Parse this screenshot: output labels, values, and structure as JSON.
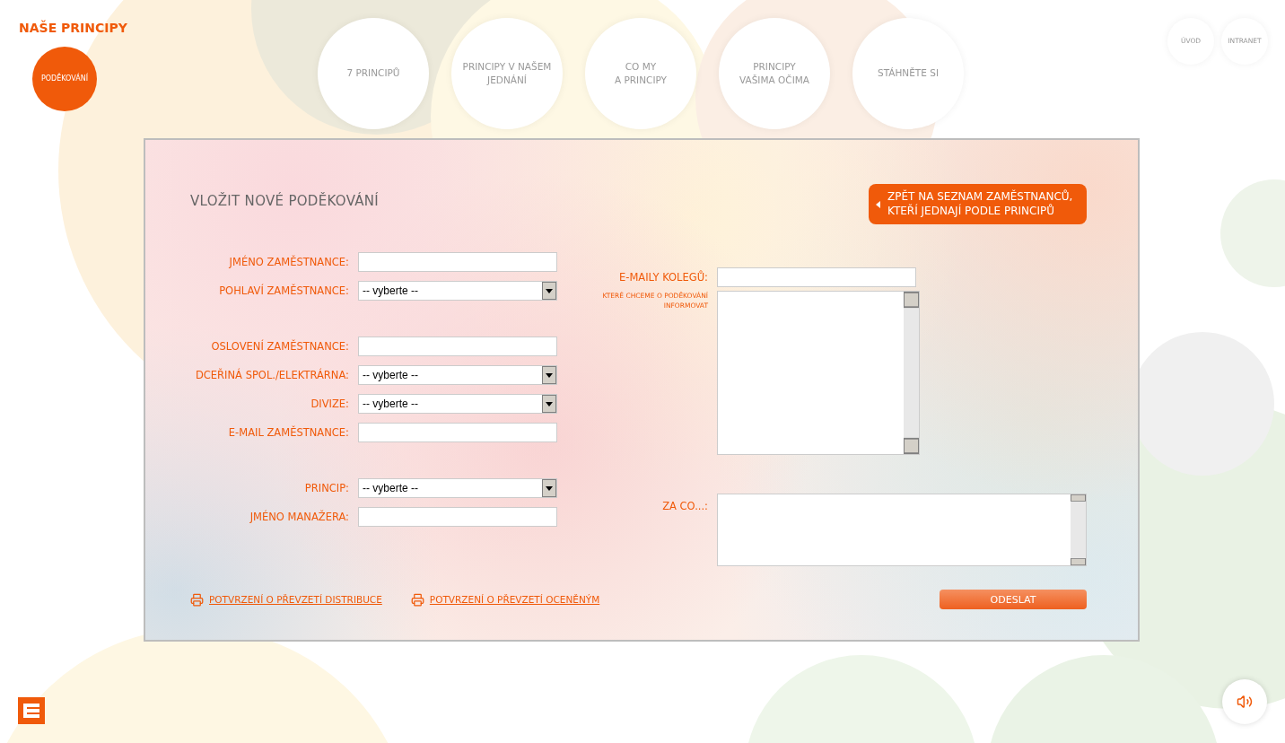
{
  "header": {
    "title": "NAŠE PRINCIPY",
    "current_item": {
      "label": "PODĚKOVÁNÍ",
      "selected": true
    },
    "nav": [
      {
        "label": "7 PRINCIPŮ",
        "selected": false
      },
      {
        "label": "PRINCIPY V NAŠEM JEDNÁNÍ",
        "selected": false
      },
      {
        "label": "CO MY\nA PRINCIPY",
        "selected": false
      },
      {
        "label": "PRINCIPY\nVAŠIMA OČIMA",
        "selected": false
      },
      {
        "label": "STÁHNĚTE SI",
        "selected": false
      }
    ],
    "utility": [
      {
        "label": "ÚVOD"
      },
      {
        "label": "INTRANET"
      }
    ]
  },
  "form": {
    "title": "VLOŽIT NOVÉ PODĚKOVÁNÍ",
    "back_button": "ZPĚT NA SEZNAM ZAMĚSTNANCŮ,\nKTEŘÍ JEDNAJÍ PODLE PRINCIPŮ",
    "groups": [
      [
        {
          "kind": "text",
          "label": "JMÉNO ZAMĚSTNANCE:"
        },
        {
          "kind": "select",
          "label": "POHLAVÍ ZAMĚSTNANCE:",
          "value": "-- vyberte --"
        }
      ],
      [
        {
          "kind": "text",
          "label": "OSLOVENÍ ZAMĚSTNANCE:"
        },
        {
          "kind": "select",
          "label": "DCEŘINÁ SPOL./ELEKTRÁRNA:",
          "value": "-- vyberte --"
        },
        {
          "kind": "select",
          "label": "DIVIZE:",
          "value": "-- vyberte --"
        },
        {
          "kind": "text",
          "label": "E-MAIL ZAMĚSTNANCE:"
        }
      ],
      [
        {
          "kind": "select",
          "label": "PRINCIP:",
          "value": "-- vyberte --"
        },
        {
          "kind": "text",
          "label": "JMÉNO MANAŽERA:"
        }
      ]
    ],
    "colleagues": {
      "label": "E-MAILY KOLEGŮ:",
      "hint": "KTERÉ CHCEME O PODĚKOVÁNÍ INFORMOVAT"
    },
    "reason": {
      "label": "ZA CO...:"
    },
    "links": [
      "POTVRZENÍ O PŘEVZETÍ DISTRIBUCE",
      "POTVRZENÍ O PŘEVZETÍ OCENĚNÝM"
    ],
    "submit": "ODESLAT"
  }
}
